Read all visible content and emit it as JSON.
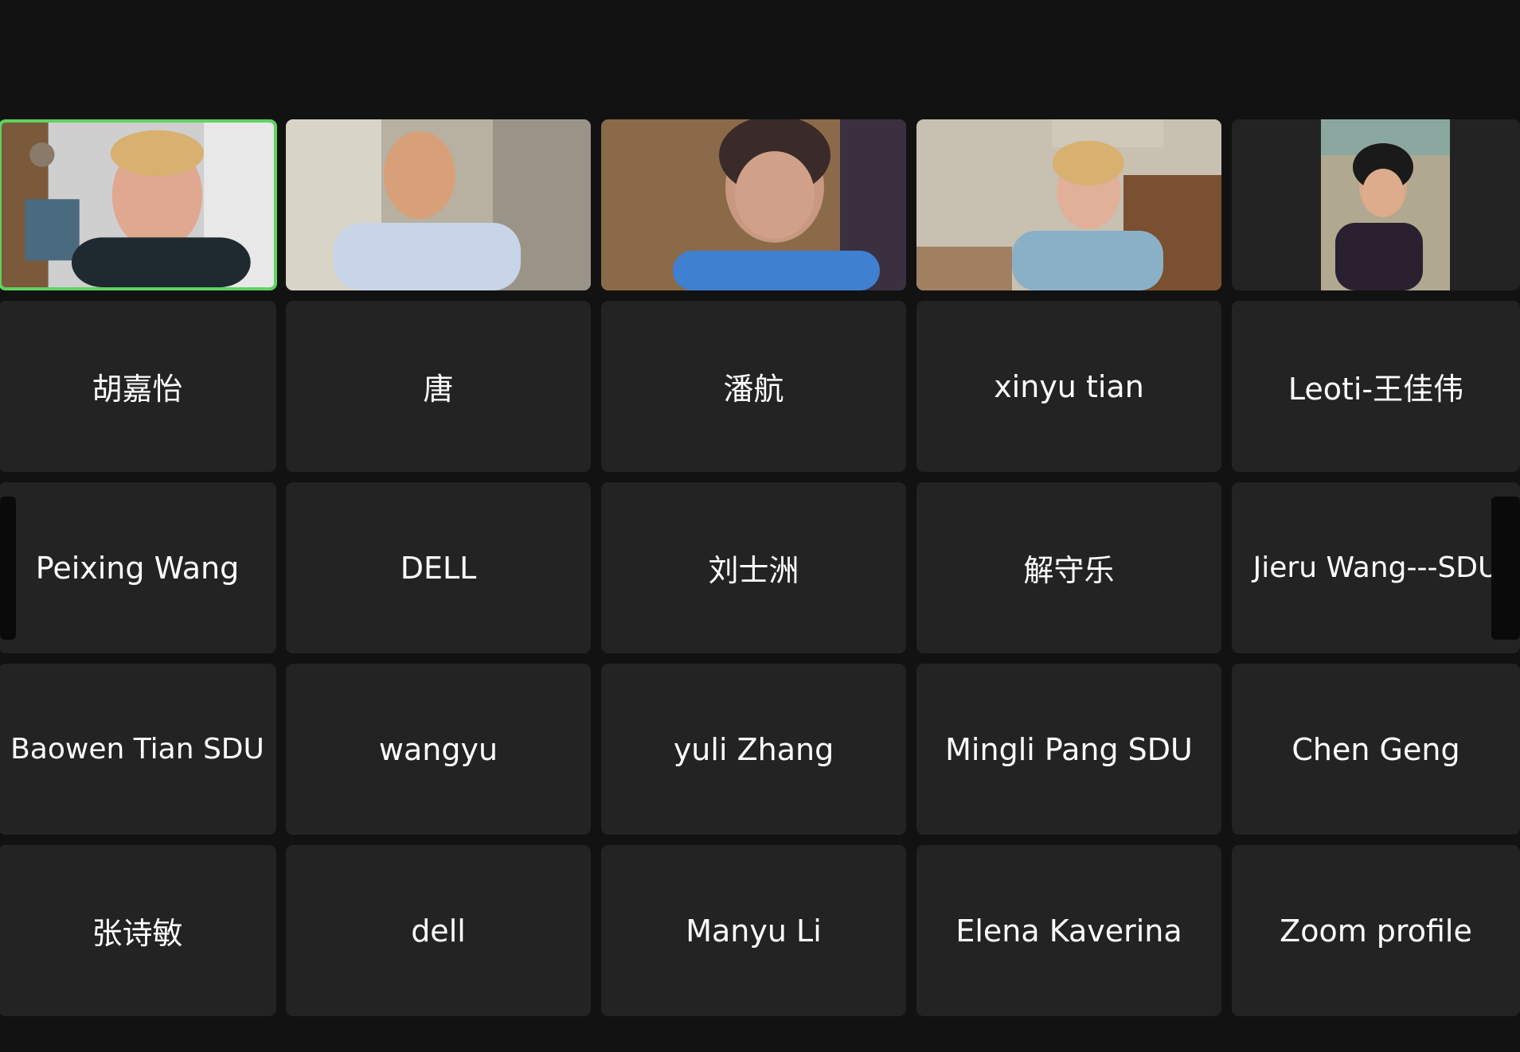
{
  "meeting": {
    "gallery": {
      "rows": [
        [
          {
            "type": "video",
            "label": "participant-video-1"
          },
          {
            "type": "video",
            "label": "participant-video-2"
          },
          {
            "type": "video",
            "label": "participant-video-3"
          },
          {
            "type": "video",
            "label": "participant-video-4"
          },
          {
            "type": "video",
            "label": "participant-video-5"
          }
        ],
        [
          {
            "type": "name",
            "name": "胡嘉怡"
          },
          {
            "type": "name",
            "name": "唐"
          },
          {
            "type": "name",
            "name": "潘航"
          },
          {
            "type": "name",
            "name": "xinyu tian"
          },
          {
            "type": "name",
            "name": "Leoti-王佳伟"
          }
        ],
        [
          {
            "type": "name",
            "name": "Peixing Wang"
          },
          {
            "type": "name",
            "name": "DELL"
          },
          {
            "type": "name",
            "name": "刘士洲"
          },
          {
            "type": "name",
            "name": "解守乐"
          },
          {
            "type": "name",
            "name": "Jieru Wang---SDU"
          }
        ],
        [
          {
            "type": "name",
            "name": "Baowen Tian SDU"
          },
          {
            "type": "name",
            "name": "wangyu"
          },
          {
            "type": "name",
            "name": "yuli Zhang"
          },
          {
            "type": "name",
            "name": "Mingli Pang SDU"
          },
          {
            "type": "name",
            "name": "Chen Geng"
          }
        ],
        [
          {
            "type": "name",
            "name": "张诗敏"
          },
          {
            "type": "name",
            "name": "dell"
          },
          {
            "type": "name",
            "name": "Manyu Li"
          },
          {
            "type": "name",
            "name": "Elena Kaverina"
          },
          {
            "type": "name",
            "name": "Zoom profile"
          }
        ]
      ]
    },
    "active_speaker_color": "#5fd35f"
  }
}
